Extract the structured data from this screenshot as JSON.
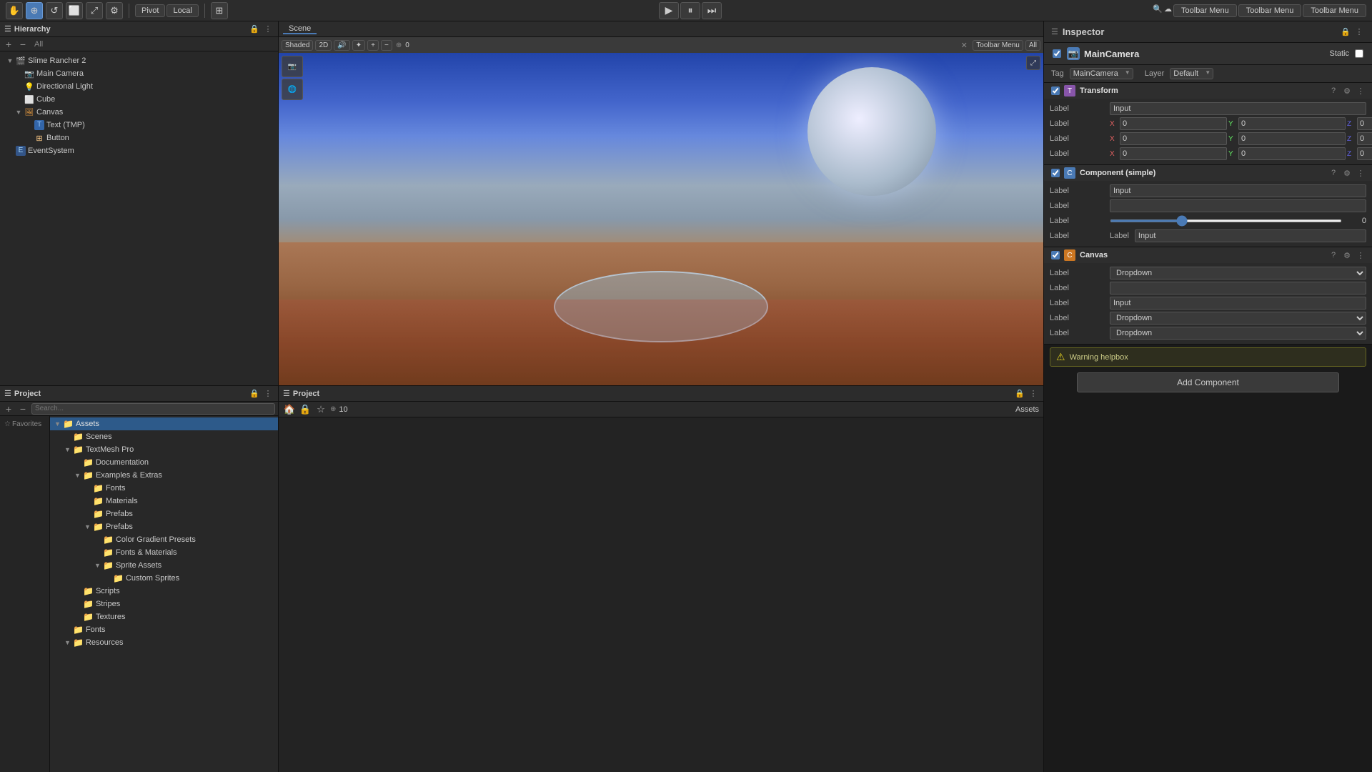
{
  "topbar": {
    "tools": [
      "✋",
      "⊕",
      "↺",
      "⬜",
      "⤢",
      "⚙"
    ],
    "pivot": "Pivot",
    "local": "Local",
    "play_icon": "▶",
    "pause_icon": "⏸",
    "step_icon": "⏭",
    "toolbar_menus": [
      "Toolbar Menu",
      "Toolbar Menu",
      "Toolbar Menu"
    ],
    "search_icon": "🔍"
  },
  "hierarchy": {
    "title": "Hierarchy",
    "all_label": "All",
    "items": [
      {
        "label": "Slime Rancher 2",
        "indent": 0,
        "has_arrow": true,
        "icon": "scene",
        "expanded": true
      },
      {
        "label": "Main Camera",
        "indent": 1,
        "has_arrow": false,
        "icon": "camera"
      },
      {
        "label": "Directional Light",
        "indent": 1,
        "has_arrow": false,
        "icon": "light"
      },
      {
        "label": "Cube",
        "indent": 1,
        "has_arrow": false,
        "icon": "cube"
      },
      {
        "label": "Canvas",
        "indent": 1,
        "has_arrow": true,
        "icon": "canvas",
        "expanded": true
      },
      {
        "label": "Text (TMP)",
        "indent": 2,
        "has_arrow": false,
        "icon": "text"
      },
      {
        "label": "Button",
        "indent": 2,
        "has_arrow": false,
        "icon": "button"
      },
      {
        "label": "EventSystem",
        "indent": 0,
        "has_arrow": false,
        "icon": "eventsystem"
      }
    ]
  },
  "scene": {
    "tab": "Scene",
    "mode": "Shaded",
    "mode_2d": "2D",
    "toolbar_menu": "Toolbar Menu",
    "all": "All"
  },
  "inspector": {
    "title": "Inspector",
    "gameobject_name": "MainCamera",
    "tag_label": "Tag",
    "tag_value": "MainCamera",
    "layer_label": "Layer",
    "layer_value": "Default",
    "static_label": "Static",
    "components": [
      {
        "name": "Transform",
        "icon": "T",
        "props": [
          {
            "label": "Label",
            "type": "input",
            "value": "Input"
          },
          {
            "label": "Label",
            "type": "xyz",
            "x": "0",
            "y": "0",
            "z": "0"
          },
          {
            "label": "Label",
            "type": "xyz",
            "x": "0",
            "y": "0",
            "z": "0"
          },
          {
            "label": "Label",
            "type": "xyz",
            "x": "0",
            "y": "0",
            "z": "0"
          }
        ]
      },
      {
        "name": "Component (simple)",
        "icon": "C",
        "props": [
          {
            "label": "Label",
            "type": "input",
            "value": "Input"
          },
          {
            "label": "Label",
            "type": "text",
            "value": ""
          },
          {
            "label": "Label",
            "type": "slider",
            "value": "0"
          },
          {
            "label": "Label",
            "type": "label-input",
            "labelval": "Label",
            "value": "Input"
          }
        ]
      },
      {
        "name": "Canvas",
        "icon": "C",
        "props": [
          {
            "label": "Label",
            "type": "dropdown",
            "value": "Dropdown"
          },
          {
            "label": "Label",
            "type": "text",
            "value": ""
          },
          {
            "label": "Label",
            "type": "input",
            "value": "Input"
          },
          {
            "label": "Label",
            "type": "dropdown",
            "value": "Dropdown"
          },
          {
            "label": "Label",
            "type": "dropdown",
            "value": "Dropdown"
          }
        ]
      }
    ],
    "warning_text": "Warning helpbox",
    "add_component": "Add Component"
  },
  "project": {
    "title": "Project",
    "favorites_label": "Favorites",
    "assets_label": "Assets",
    "tree": [
      {
        "label": "Assets",
        "indent": 0,
        "type": "folder",
        "expanded": true,
        "selected": true
      },
      {
        "label": "Scenes",
        "indent": 1,
        "type": "folder"
      },
      {
        "label": "TextMesh Pro",
        "indent": 1,
        "type": "folder",
        "expanded": true
      },
      {
        "label": "Documentation",
        "indent": 2,
        "type": "folder"
      },
      {
        "label": "Examples & Extras",
        "indent": 2,
        "type": "folder",
        "expanded": true
      },
      {
        "label": "Fonts",
        "indent": 3,
        "type": "folder"
      },
      {
        "label": "Materials",
        "indent": 3,
        "type": "folder"
      },
      {
        "label": "Prefabs",
        "indent": 3,
        "type": "folder"
      },
      {
        "label": "Prefabs",
        "indent": 3,
        "type": "folder",
        "expanded": true
      },
      {
        "label": "Color Gradient Presets",
        "indent": 4,
        "type": "folder"
      },
      {
        "label": "Fonts & Materials",
        "indent": 4,
        "type": "folder"
      },
      {
        "label": "Sprite Assets",
        "indent": 4,
        "type": "folder",
        "expanded": true
      },
      {
        "label": "Custom Sprites",
        "indent": 5,
        "type": "folder"
      },
      {
        "label": "Scripts",
        "indent": 2,
        "type": "folder"
      },
      {
        "label": "Stripes",
        "indent": 2,
        "type": "folder"
      },
      {
        "label": "Textures",
        "indent": 2,
        "type": "folder"
      },
      {
        "label": "Fonts",
        "indent": 1,
        "type": "folder"
      },
      {
        "label": "Resources",
        "indent": 1,
        "type": "folder",
        "expanded": true
      }
    ]
  },
  "icons": {
    "folder": "📁",
    "scene": "🎬",
    "camera": "📷",
    "light": "💡",
    "cube": "🎲",
    "canvas": "🖼",
    "text": "T",
    "button": "⊞",
    "arrow_right": "▶",
    "arrow_down": "▼",
    "warning": "⚠"
  }
}
